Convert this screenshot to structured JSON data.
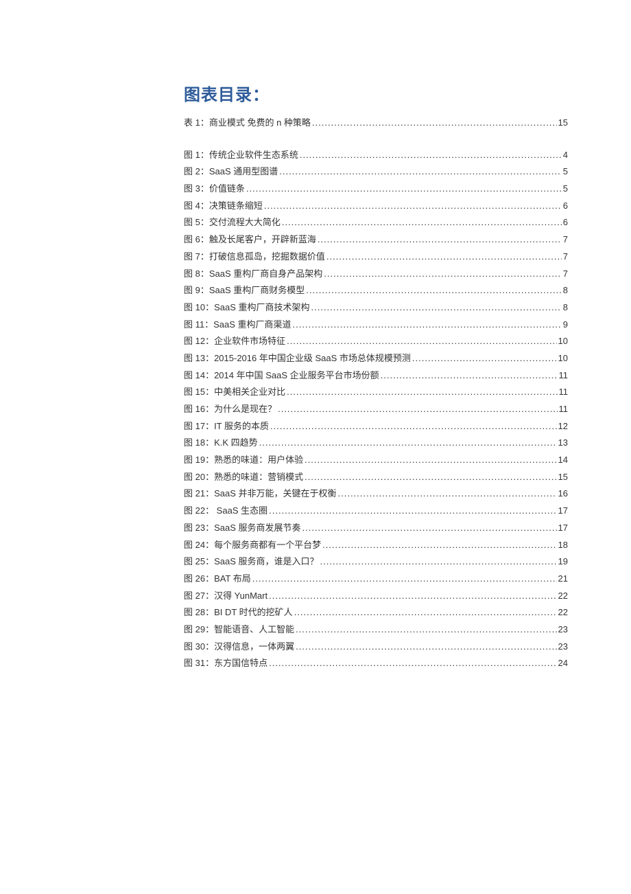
{
  "title": "图表目录：",
  "tables": [
    {
      "label": "表 1：商业模式 免费的 n 种策略",
      "page": "15"
    }
  ],
  "figures": [
    {
      "label": "图 1：传统企业软件生态系统",
      "page": "4"
    },
    {
      "label": "图 2：SaaS 通用型图谱",
      "page": "5"
    },
    {
      "label": "图 3：价值链条",
      "page": "5"
    },
    {
      "label": "图 4：决策链条缩短",
      "page": "6"
    },
    {
      "label": "图 5：交付流程大大简化",
      "page": "6"
    },
    {
      "label": "图 6：触及长尾客户，开辟新蓝海",
      "page": "7"
    },
    {
      "label": "图 7：打破信息孤岛，挖掘数据价值",
      "page": "7"
    },
    {
      "label": "图 8：SaaS 重构厂商自身产品架构",
      "page": "7"
    },
    {
      "label": "图 9：SaaS 重构厂商财务模型",
      "page": "8"
    },
    {
      "label": "图 10：SaaS 重构厂商技术架构",
      "page": "8"
    },
    {
      "label": "图 11：SaaS 重构厂商渠道",
      "page": "9"
    },
    {
      "label": "图 12：企业软件市场特征",
      "page": "10"
    },
    {
      "label": "图 13：2015-2016 年中国企业级 SaaS 市场总体规模预测",
      "page": "10"
    },
    {
      "label": "图 14：2014 年中国 SaaS 企业服务平台市场份额",
      "page": "11"
    },
    {
      "label": "图 15：中美相关企业对比",
      "page": "11"
    },
    {
      "label": "图 16：为什么是现在？",
      "page": "11"
    },
    {
      "label": "图 17：IT 服务的本质",
      "page": "12"
    },
    {
      "label": "图 18：K.K 四趋势",
      "page": "13"
    },
    {
      "label": "图 19：熟悉的味道：用户体验",
      "page": "14"
    },
    {
      "label": "图 20：熟悉的味道：营销模式",
      "page": "15"
    },
    {
      "label": "图 21：SaaS 并非万能，关键在于权衡",
      "page": "16"
    },
    {
      "label": "图 22：  SaaS 生态圈",
      "page": "17"
    },
    {
      "label": "图 23：SaaS 服务商发展节奏",
      "page": "17"
    },
    {
      "label": "图 24：每个服务商都有一个平台梦",
      "page": "18"
    },
    {
      "label": "图 25：SaaS 服务商，谁是入口？",
      "page": "19"
    },
    {
      "label": "图 26：BAT 布局",
      "page": "21"
    },
    {
      "label": "图 27：汉得 YunMart",
      "page": "22"
    },
    {
      "label": "图 28：BI  DT 时代的挖矿人",
      "page": "22"
    },
    {
      "label": "图 29：智能语音、人工智能",
      "page": "23"
    },
    {
      "label": "图 30：汉得信息，一体两翼",
      "page": "23"
    },
    {
      "label": "图 31：东方国信特点",
      "page": "24"
    }
  ]
}
